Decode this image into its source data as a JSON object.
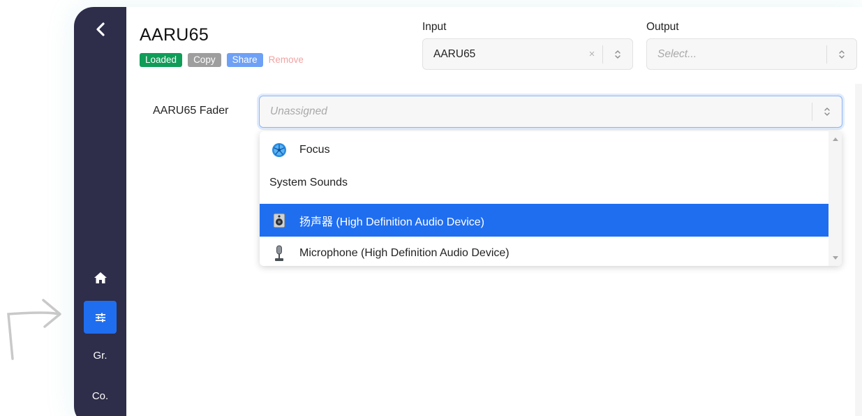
{
  "sidebar": {
    "back_icon": "chevron-left-icon",
    "home_icon": "home-icon",
    "mixer_icon": "sliders-icon",
    "items": [
      {
        "label": "Gr."
      },
      {
        "label": "Co."
      }
    ]
  },
  "header": {
    "title": "AARU65",
    "badges": {
      "loaded": "Loaded",
      "copy": "Copy",
      "share": "Share",
      "remove": "Remove"
    }
  },
  "input": {
    "label": "Input",
    "value": "AARU65",
    "clear": "×"
  },
  "output": {
    "label": "Output",
    "placeholder": "Select..."
  },
  "fader": {
    "label": "AARU65 Fader",
    "placeholder": "Unassigned"
  },
  "dropdown": {
    "options": [
      {
        "label": "Focus",
        "icon": "app-fan-icon"
      },
      {
        "label": "System Sounds",
        "group": true
      },
      {
        "label": "扬声器 (High Definition Audio Device)",
        "icon": "speaker-icon",
        "selected": true
      },
      {
        "label": "Microphone (High Definition Audio Device)",
        "icon": "microphone-icon"
      }
    ]
  },
  "colors": {
    "sidebar_bg": "#2e2d4a",
    "accent": "#1f6ef0",
    "loaded": "#0f9d58",
    "copy": "#9e9e9e",
    "share": "#6ea0f5",
    "remove": "#f3a3a3"
  }
}
